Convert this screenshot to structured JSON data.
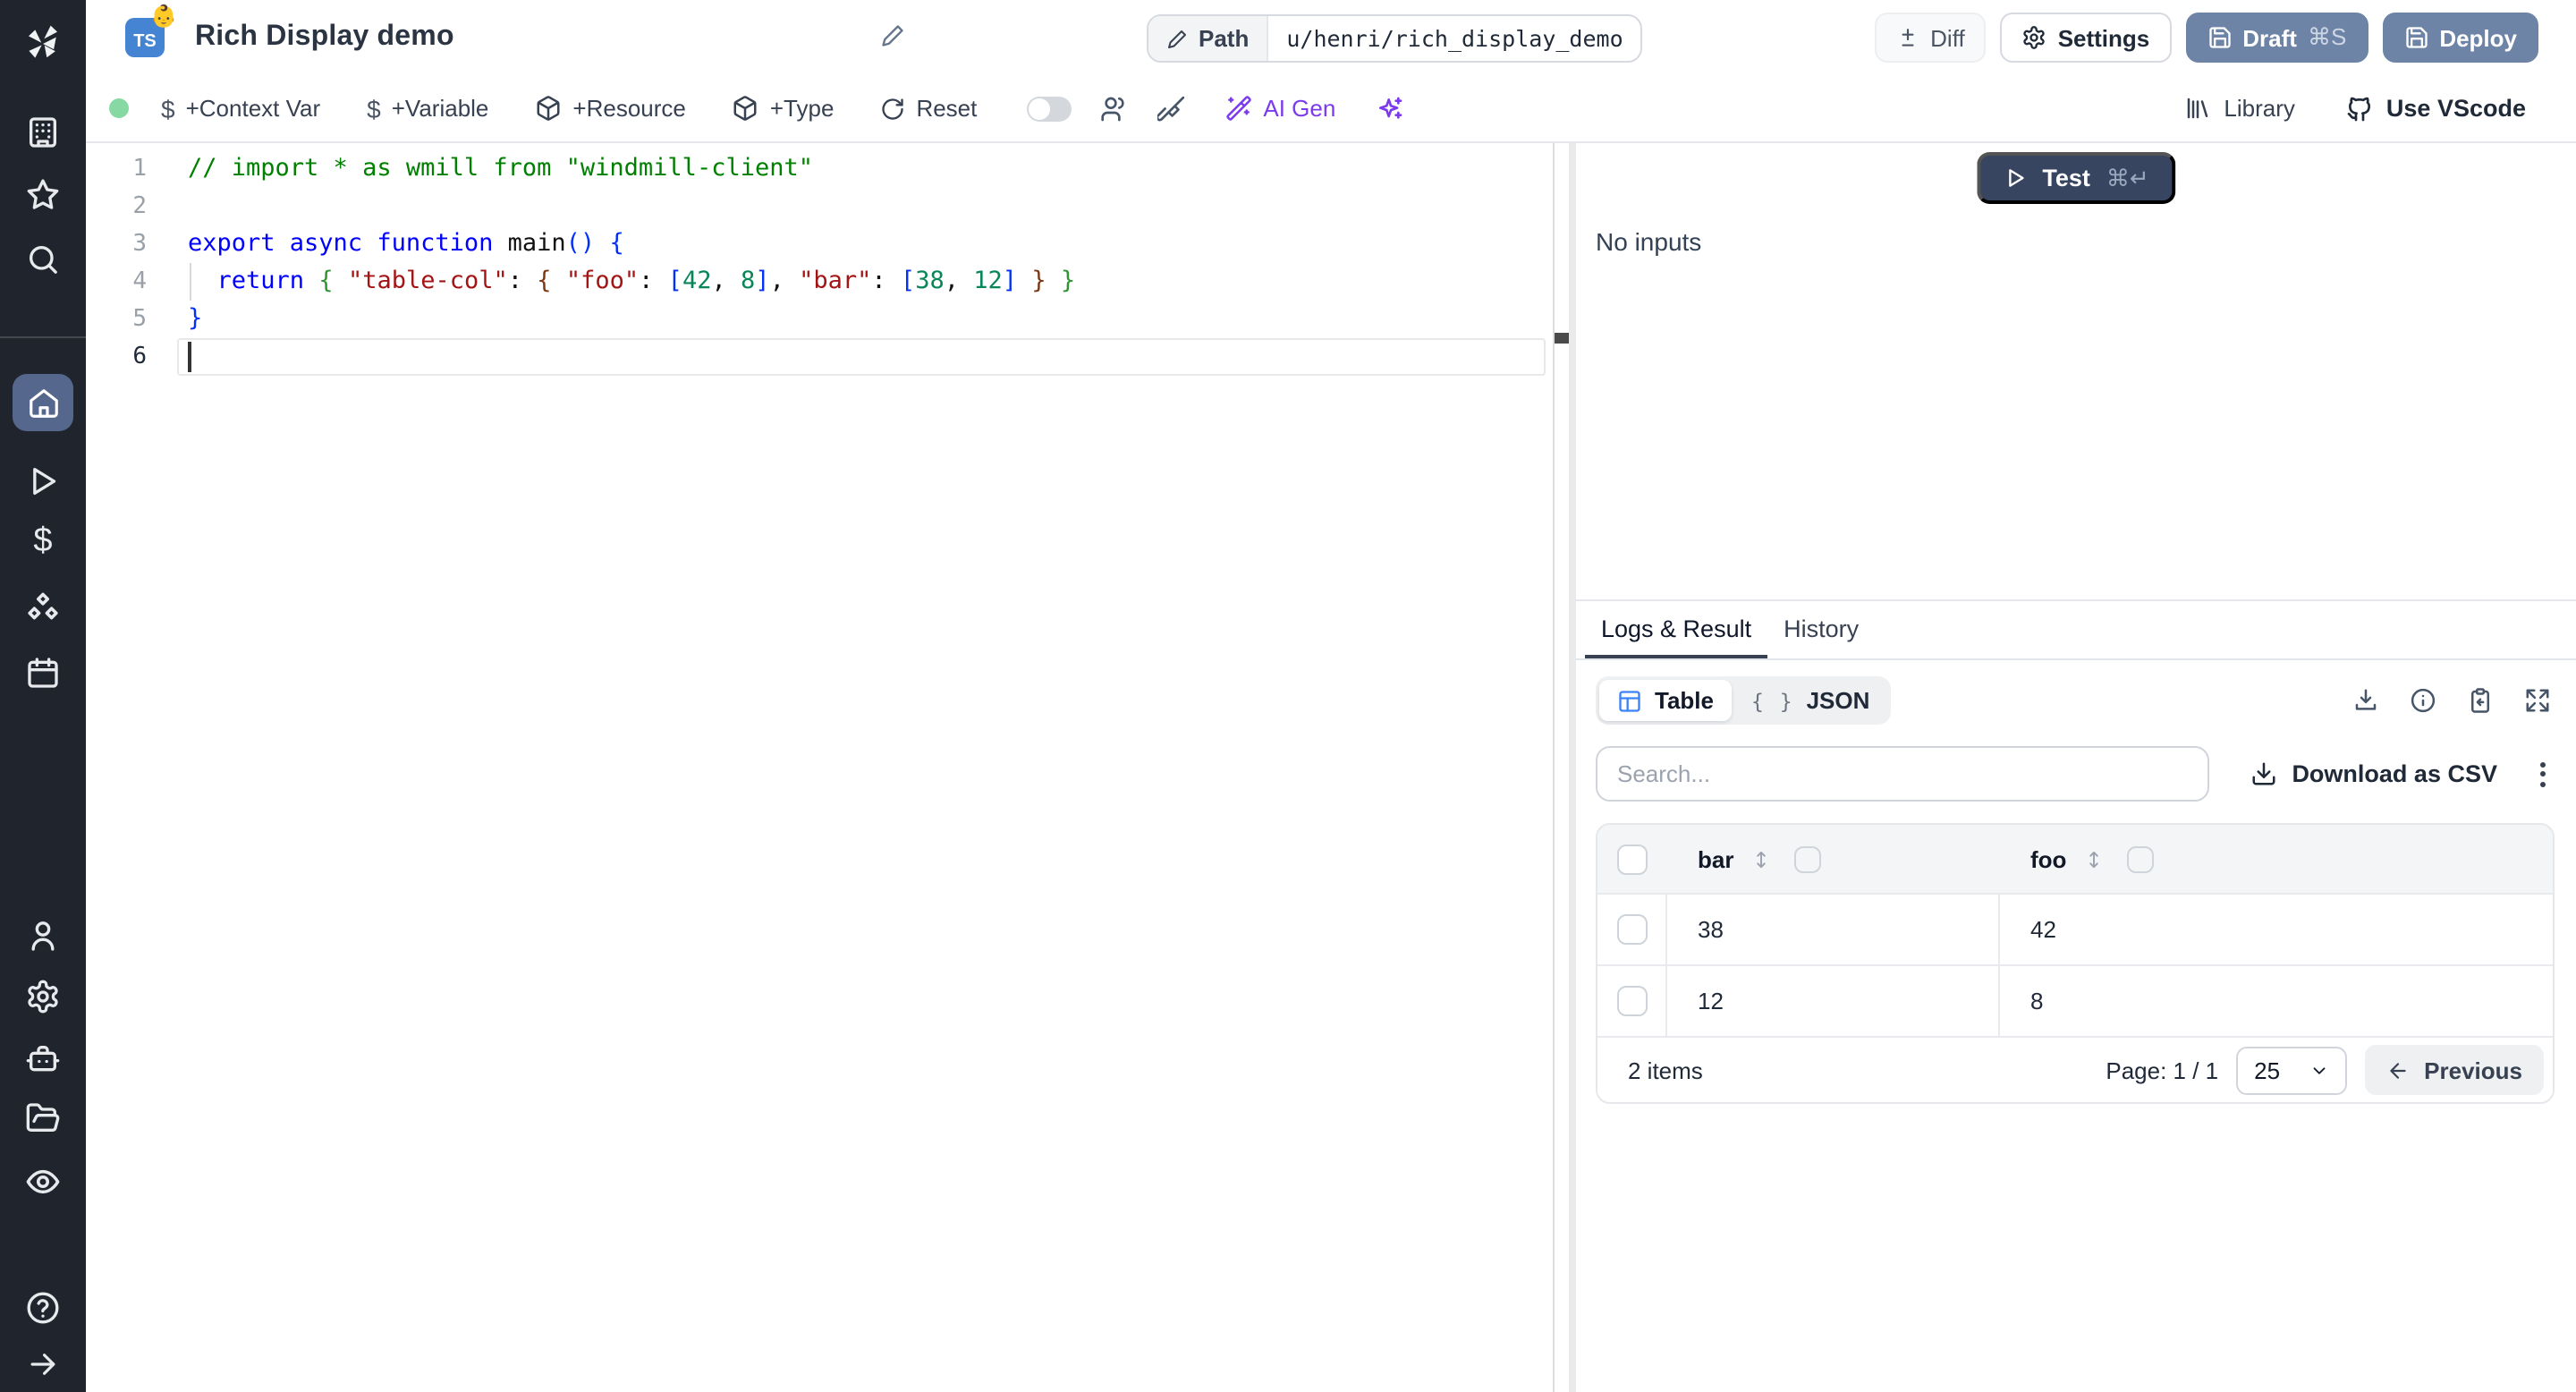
{
  "topbar": {
    "ts_badge": "TS",
    "emoji": "👶",
    "title": "Rich Display demo",
    "path_label": "Path",
    "path_value": "u/henri/rich_display_demo",
    "diff_label": "Diff",
    "settings_label": "Settings",
    "draft_label": "Draft",
    "draft_kbd": "⌘S",
    "deploy_label": "Deploy"
  },
  "toolbar": {
    "context_var_label": "+Context Var",
    "variable_label": "+Variable",
    "resource_label": "+Resource",
    "type_label": "+Type",
    "reset_label": "Reset",
    "ai_gen_label": "AI Gen",
    "library_label": "Library",
    "vscode_label": "Use VScode",
    "dollar_glyph": "$"
  },
  "editor": {
    "line_numbers": [
      "1",
      "2",
      "3",
      "4",
      "5",
      "6"
    ],
    "active_line": 6,
    "lines": [
      [
        {
          "c": "comment",
          "t": "// import * as wmill from \"windmill-client\""
        }
      ],
      [],
      [
        {
          "c": "kw",
          "t": "export async function "
        },
        {
          "c": "fn",
          "t": "main"
        },
        {
          "c": "b1",
          "t": "()"
        },
        {
          "c": "plain",
          "t": " "
        },
        {
          "c": "b1",
          "t": "{"
        }
      ],
      [
        {
          "c": "plain",
          "t": "  "
        },
        {
          "c": "kw",
          "t": "return"
        },
        {
          "c": "plain",
          "t": " "
        },
        {
          "c": "b2",
          "t": "{"
        },
        {
          "c": "plain",
          "t": " "
        },
        {
          "c": "str",
          "t": "\"table-col\""
        },
        {
          "c": "plain",
          "t": ": "
        },
        {
          "c": "b3",
          "t": "{"
        },
        {
          "c": "plain",
          "t": " "
        },
        {
          "c": "str",
          "t": "\"foo\""
        },
        {
          "c": "plain",
          "t": ": "
        },
        {
          "c": "b1",
          "t": "["
        },
        {
          "c": "num",
          "t": "42"
        },
        {
          "c": "plain",
          "t": ", "
        },
        {
          "c": "num",
          "t": "8"
        },
        {
          "c": "b1",
          "t": "]"
        },
        {
          "c": "plain",
          "t": ", "
        },
        {
          "c": "str",
          "t": "\"bar\""
        },
        {
          "c": "plain",
          "t": ": "
        },
        {
          "c": "b1",
          "t": "["
        },
        {
          "c": "num",
          "t": "38"
        },
        {
          "c": "plain",
          "t": ", "
        },
        {
          "c": "num",
          "t": "12"
        },
        {
          "c": "b1",
          "t": "]"
        },
        {
          "c": "plain",
          "t": " "
        },
        {
          "c": "b3",
          "t": "}"
        },
        {
          "c": "plain",
          "t": " "
        },
        {
          "c": "b2",
          "t": "}"
        }
      ],
      [
        {
          "c": "b1",
          "t": "}"
        }
      ],
      []
    ]
  },
  "preview": {
    "test_label": "Test",
    "test_kbd": "⌘↵",
    "no_inputs": "No inputs"
  },
  "results": {
    "tab_logs": "Logs & Result",
    "tab_history": "History",
    "view_table_label": "Table",
    "view_json_label": "JSON",
    "json_braces": "{ }",
    "search_placeholder": "Search...",
    "download_csv_label": "Download as CSV"
  },
  "table": {
    "columns": [
      "bar",
      "foo"
    ],
    "rows": [
      [
        "38",
        "42"
      ],
      [
        "12",
        "8"
      ]
    ],
    "items_label": "2 items",
    "page_label": "Page: 1 / 1",
    "page_size": "25",
    "previous_label": "Previous"
  },
  "colors": {
    "sidebar_bg": "#1f242d",
    "sidebar_active_bg": "#55678c",
    "slate_button": "#6e84a6",
    "test_button": "#374560",
    "ts_badge": "#4584d3",
    "accent_blue": "#3b82f6",
    "ai_purple": "#7c3aed",
    "status_green": "#86d9a3",
    "code_comment": "#008000",
    "code_keyword": "#0000ff",
    "code_string": "#a31515",
    "code_number": "#098658"
  }
}
